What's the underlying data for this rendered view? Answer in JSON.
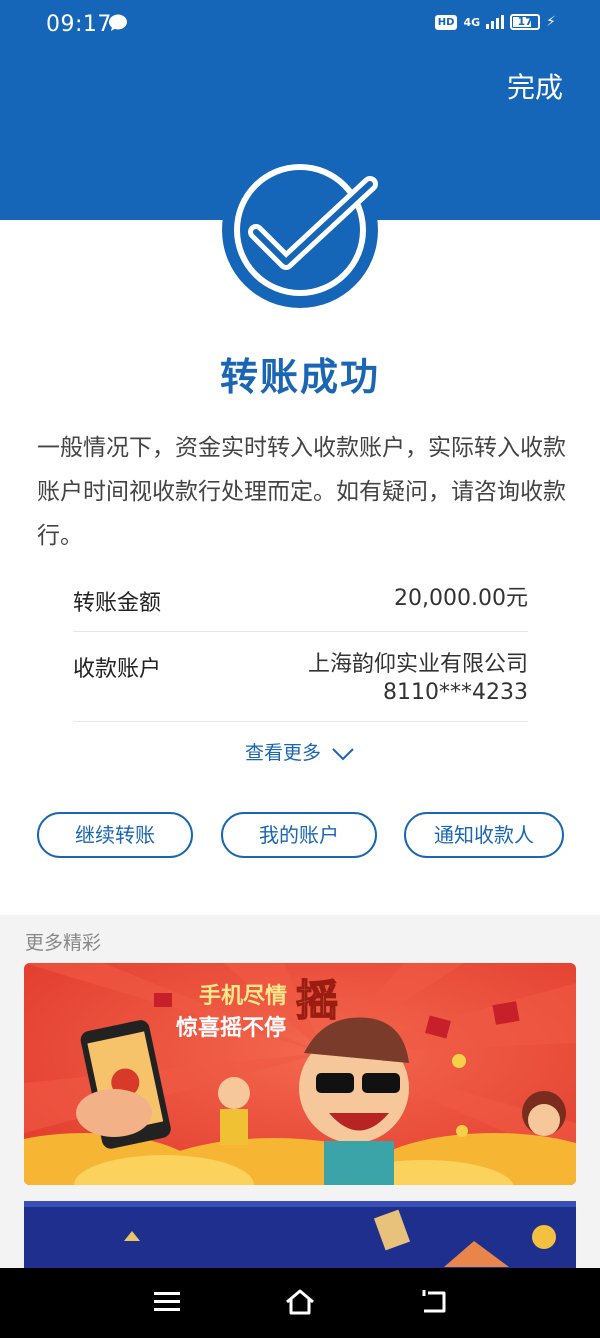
{
  "status_bar": {
    "time": "09:17",
    "hd_label": "HD",
    "network_label": "4G",
    "battery": "17"
  },
  "header": {
    "done_label": "完成",
    "accent_color": "#1565b9"
  },
  "result": {
    "title": "转账成功",
    "description": "一般情况下，资金实时转入收款账户，实际转入收款账户时间视收款行处理而定。如有疑问，请咨询收款行。"
  },
  "details": {
    "amount_label": "转账金额",
    "amount_value": "20,000.00元",
    "account_label": "收款账户",
    "account_name": "上海韵仰实业有限公司",
    "account_number": "8110***4233"
  },
  "view_more_label": "查看更多",
  "actions": {
    "continue_label": "继续转账",
    "my_account_label": "我的账户",
    "notify_label": "通知收款人"
  },
  "promotions": {
    "section_title": "更多精彩",
    "banner1_line1": "手机尽情",
    "banner1_highlight": "摇",
    "banner1_line2": "惊喜摇不停"
  }
}
